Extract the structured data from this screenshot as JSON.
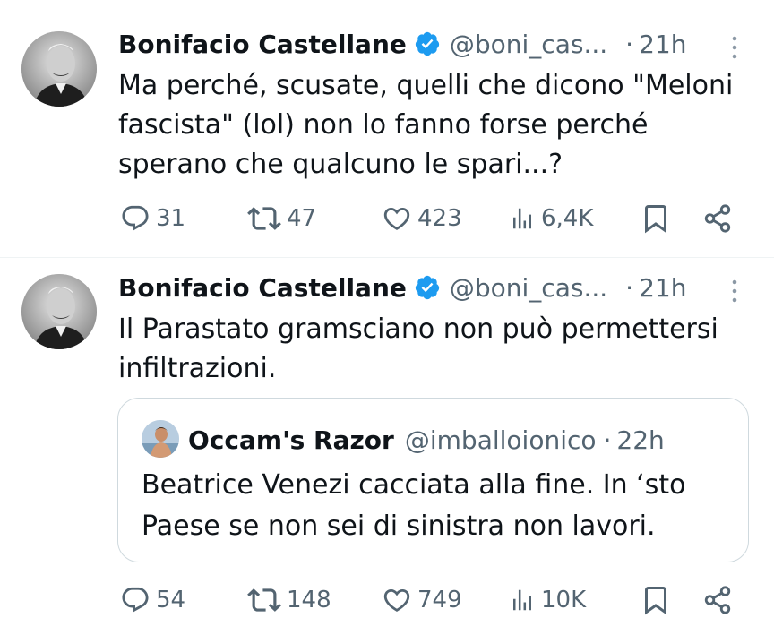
{
  "tweets": [
    {
      "author": "Bonifacio Castellane",
      "handle": "@boni_cas...",
      "separator": "·",
      "time": "21h",
      "text_lines": [
        "Ma perché, scusate, quelli che dicono \"Meloni",
        "fascista\" (lol) non lo fanno forse perché",
        "sperano che qualcuno le spari...?"
      ],
      "stats": {
        "replies": "31",
        "reposts": "47",
        "likes": "423",
        "views": "6,4K"
      }
    },
    {
      "author": "Bonifacio Castellane",
      "handle": "@boni_cas...",
      "separator": "·",
      "time": "21h",
      "text_lines": [
        "Il Parastato gramsciano non può permettersi",
        "infiltrazioni."
      ],
      "quote": {
        "author": "Occam's Razor",
        "handle": "@imballoionico",
        "separator": "·",
        "time": "22h",
        "text_lines": [
          "Beatrice Venezi cacciata alla fine. In ‘sto",
          "Paese se non sei di sinistra non lavori."
        ]
      },
      "stats": {
        "replies": "54",
        "reposts": "148",
        "likes": "749",
        "views": "10K"
      }
    }
  ],
  "icons": {
    "verified": "verified-badge-icon",
    "more": "more-icon",
    "reply": "reply-icon",
    "repost": "repost-icon",
    "like": "like-icon",
    "views": "views-icon",
    "bookmark": "bookmark-icon",
    "share": "share-icon"
  },
  "colors": {
    "verified": "#1d9bf0",
    "secondary_text": "#536471",
    "divider": "#eff3f4",
    "border": "#cfd9de"
  }
}
